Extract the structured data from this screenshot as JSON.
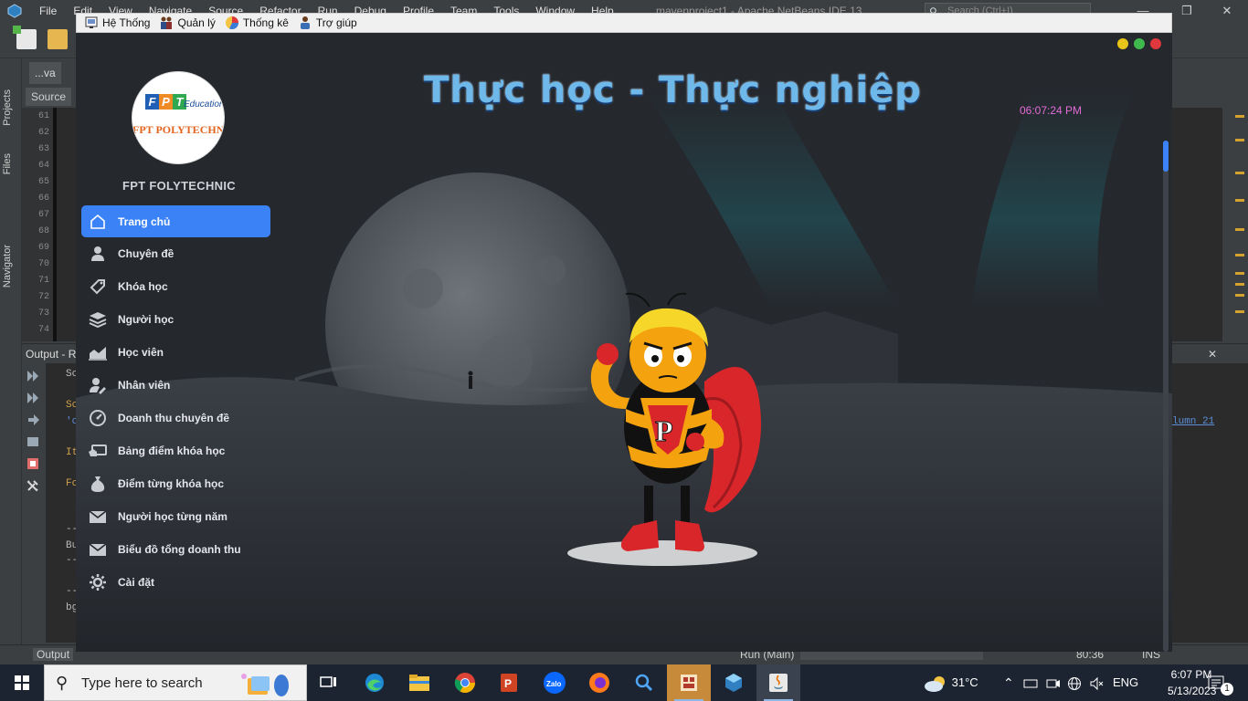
{
  "ide": {
    "menu": [
      "File",
      "Edit",
      "View",
      "Navigate",
      "Source",
      "Refactor",
      "Run",
      "Debug",
      "Profile",
      "Team",
      "Tools",
      "Window",
      "Help"
    ],
    "title": "mavenproject1 - Apache NetBeans IDE 13",
    "search_placeholder": "Search (Ctrl+I)",
    "editor_tab": "...va",
    "source_tab": "Source",
    "side_tabs": [
      "Projects",
      "Files",
      "Navigator"
    ],
    "line_numbers": [
      "61",
      "62",
      "63",
      "64",
      "65",
      "66",
      "67",
      "68",
      "69",
      "70",
      "71",
      "72",
      "73",
      "74"
    ],
    "output_title": "Output - R",
    "output_lines": [
      "Sc",
      "Sc",
      "'c",
      "It",
      "Fc",
      "--",
      "Bu",
      "--",
      "--",
      "bg"
    ],
    "output_link": "lumn 21",
    "status_output_tab": "Output",
    "status_run": "Run (Main)",
    "status_position": "80:36",
    "status_mode": "INS"
  },
  "app": {
    "menubar": [
      {
        "label": "Hệ Thống",
        "icon": "system-icon"
      },
      {
        "label": "Quản lý",
        "icon": "people-icon"
      },
      {
        "label": "Thống kê",
        "icon": "chart-icon"
      },
      {
        "label": "Trợ giúp",
        "icon": "help-icon"
      }
    ],
    "logo": {
      "letters": [
        "F",
        "P",
        "T"
      ],
      "education": "Education",
      "polytechnic": "FPT POLYTECHNIC"
    },
    "brand_name": "FPT FOLYTECHNIC",
    "headline": "Thực học - Thực nghiệp",
    "clock": "06:07:24 PM",
    "window_dots": [
      "#e8c518",
      "#3fb84e",
      "#e0383c"
    ],
    "accent": "#3b82f6",
    "nav": [
      {
        "label": "Trang chủ",
        "icon": "home-icon",
        "active": true
      },
      {
        "label": "Chuyên đề",
        "icon": "user-icon"
      },
      {
        "label": "Khóa học",
        "icon": "tag-icon"
      },
      {
        "label": "Người học",
        "icon": "layers-icon"
      },
      {
        "label": "Học viên",
        "icon": "area-chart-icon"
      },
      {
        "label": "Nhân viên",
        "icon": "user-edit-icon"
      },
      {
        "label": "Doanh thu chuyên đề",
        "icon": "gauge-icon"
      },
      {
        "label": "Bảng điểm khóa học",
        "icon": "card-icon"
      },
      {
        "label": "Điểm từng khóa học",
        "icon": "money-bag-icon"
      },
      {
        "label": "Người học từng năm",
        "icon": "mail-icon"
      },
      {
        "label": "Biểu đồ tổng doanh thu",
        "icon": "mail-icon"
      },
      {
        "label": "Cài đặt",
        "icon": "gear-icon"
      }
    ]
  },
  "taskbar": {
    "search_placeholder": "Type here to search",
    "apps": [
      "task-view-icon",
      "edge-icon",
      "file-explorer-icon",
      "chrome-icon",
      "powerpoint-icon",
      "zalo-icon",
      "firefox-icon",
      "search-app-icon",
      "app-icon",
      "netbeans-icon",
      "java-icon"
    ],
    "weather": "31°C",
    "language": "ENG",
    "time": "6:07 PM",
    "date": "5/13/2023",
    "notification_count": "1"
  }
}
